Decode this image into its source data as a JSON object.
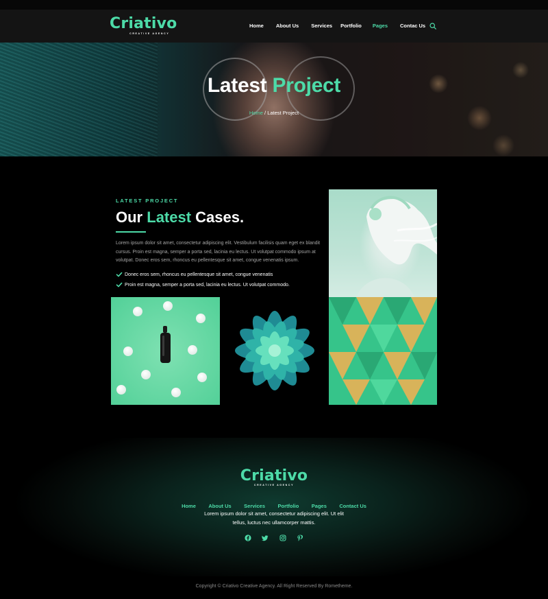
{
  "brand": {
    "name": "Criativo",
    "tagline": "CREATIVE AGENCY",
    "accent": "#4ddba8"
  },
  "header": {
    "nav": [
      "Home",
      "About Us",
      "Services",
      "Portfolio",
      "Pages",
      "Contac Us"
    ],
    "active": "Pages",
    "search_icon": "search-icon"
  },
  "hero": {
    "title_plain": "Latest",
    "title_accent": "Project",
    "breadcrumb_home": "Home",
    "breadcrumb_sep": " / ",
    "breadcrumb_current": "Latest Project"
  },
  "section": {
    "eyebrow": "LATEST PROJECT",
    "heading_a": "Our",
    "heading_accent": "Latest",
    "heading_b": "Cases.",
    "paragraph": "Lorem ipsum dolor sit amet, consectetur adipiscing elit. Vestibulum facilisis quam eget ex blandit cursus. Proin est magna, semper a porta sed, lacinia eu lectus. Ut volutpat commodo ipsum at volutpat. Donec eros sem, rhoncus eu pellentesque sit amet, congue venenatis ipsum.",
    "checks": [
      "Donec eros sem, rhoncus eu pellentesque sit amet, congue venenatis",
      "Proin est magna, semper a porta sed, lacinia eu lectus. Ut volutpat commodo."
    ]
  },
  "footer": {
    "nav": [
      "Home",
      "About Us",
      "Services",
      "Portfolio",
      "Pages",
      "Contact Us"
    ],
    "text_line1": "Lorem ipsum dolor sit amet, consectetur adipiscing elit. Ut elit",
    "text_line2": "tellus, luctus nec ullamcorper mattis.",
    "socials": [
      "facebook-icon",
      "twitter-icon",
      "instagram-icon",
      "pinterest-icon"
    ],
    "copyright": "Copyright © Criativo Creative Agency. All Right Reserved By Rometheme."
  }
}
